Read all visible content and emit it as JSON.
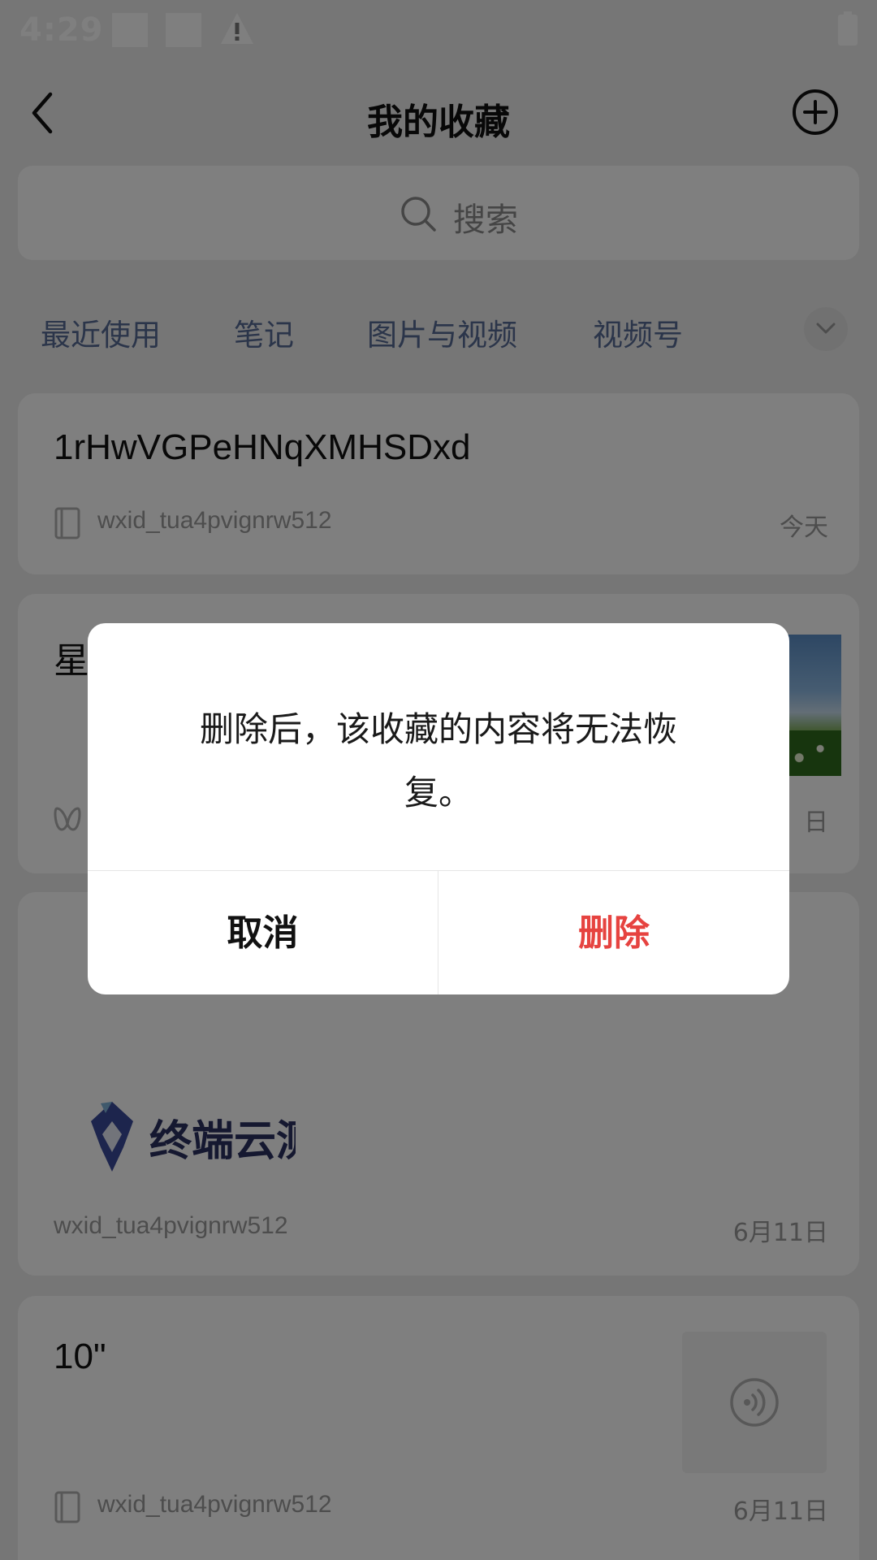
{
  "status_bar": {
    "time": "4:29"
  },
  "header": {
    "title": "我的收藏"
  },
  "search": {
    "placeholder": "搜索"
  },
  "tabs": [
    "最近使用",
    "笔记",
    "图片与视频",
    "视频号"
  ],
  "cards": [
    {
      "title": "1rHwVGPeHNqXMHSDxd",
      "source": "wxid_tua4pvignrw512",
      "date": "今天"
    },
    {
      "title": "星",
      "date": "日"
    },
    {
      "logo_text": "终端云测",
      "source": "wxid_tua4pvignrw512",
      "date": "6月11日"
    },
    {
      "title": "10\"",
      "source": "wxid_tua4pvignrw512",
      "date": "6月11日"
    }
  ],
  "dialog": {
    "message": "删除后，该收藏的内容将无法恢复。",
    "cancel_label": "取消",
    "delete_label": "删除"
  },
  "colors": {
    "link_blue": "#576b95",
    "danger_red": "#e64340",
    "page_bg": "#ededed"
  }
}
